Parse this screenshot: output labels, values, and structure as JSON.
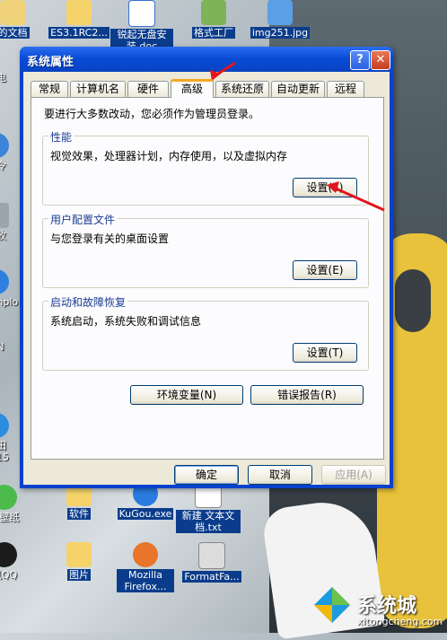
{
  "desktop": {
    "top_icons": [
      {
        "label": "的文档",
        "name": "my-documents-icon"
      },
      {
        "label": "ES3.1RC2...",
        "name": "folder-icon"
      },
      {
        "label": "锐起无盘安装.doc",
        "name": "word-doc-icon"
      },
      {
        "label": "格式工厂",
        "name": "format-factory-icon"
      },
      {
        "label": "img251.jpg",
        "name": "image-file-icon"
      }
    ],
    "left_icons": [
      {
        "label": "的电",
        "name": "my-computer-icon"
      },
      {
        "label": "上令",
        "name": "network-icon"
      },
      {
        "label": "回收",
        "name": "recycle-bin-icon"
      },
      {
        "label": "ternplo",
        "name": "ie-icon"
      },
      {
        "label": "ON",
        "name": "app-icon"
      },
      {
        "label": "里田2015",
        "name": "app-icon-2"
      },
      {
        "label": "度壁纸",
        "name": "wallpaper-app-icon"
      },
      {
        "label": "讯QQ",
        "name": "qq-icon"
      }
    ],
    "bottom_icons": [
      {
        "label": "软件",
        "name": "software-folder-icon"
      },
      {
        "label": "KuGou.exe",
        "name": "kugou-icon"
      },
      {
        "label": "新建 文本文档.txt",
        "name": "text-file-icon"
      },
      {
        "label": "图片",
        "name": "pictures-folder-icon"
      },
      {
        "label": "Mozilla Firefox...",
        "name": "firefox-icon"
      },
      {
        "label": "FormatFa...",
        "name": "format-factory-file-icon"
      }
    ],
    "watermark": {
      "brand": "系统城",
      "url": "xitongcheng.com"
    }
  },
  "dialog": {
    "title": "系统属性",
    "help_glyph": "?",
    "close_glyph": "✕",
    "tabs": [
      "常规",
      "计算机名",
      "硬件",
      "高级",
      "系统还原",
      "自动更新",
      "远程"
    ],
    "active_tab": "高级",
    "admin_note": "要进行大多数改动，您必须作为管理员登录。",
    "performance": {
      "title": "性能",
      "description": "视觉效果，处理器计划，内存使用，以及虚拟内存",
      "button": "设置(S)"
    },
    "user_profiles": {
      "title": "用户配置文件",
      "description": "与您登录有关的桌面设置",
      "button": "设置(E)"
    },
    "startup_recovery": {
      "title": "启动和故障恢复",
      "description": "系统启动，系统失败和调试信息",
      "button": "设置(T)"
    },
    "env_button": "环境变量(N)",
    "error_report_button": "错误报告(R)",
    "ok_button": "确定",
    "cancel_button": "取消",
    "apply_button": "应用(A)"
  },
  "colors": {
    "titlebar": "#0a4cd6",
    "dialog_bg": "#ece9d8",
    "annotation_arrow": "#e0161b"
  }
}
